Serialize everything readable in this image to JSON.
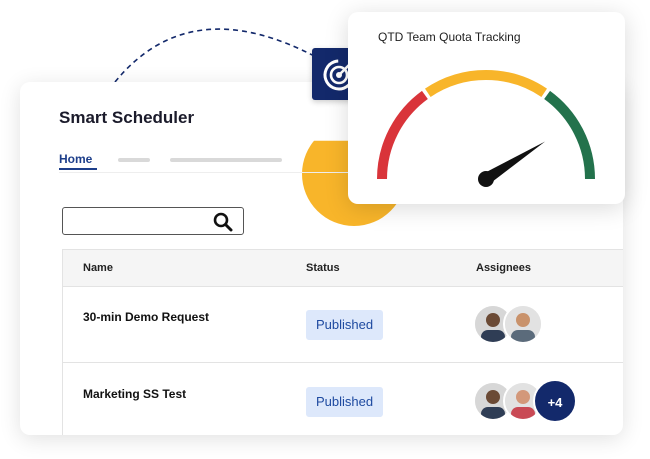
{
  "app": {
    "title": "Smart Scheduler",
    "nav": {
      "home_label": "Home"
    }
  },
  "search": {
    "placeholder": "",
    "value": ""
  },
  "table": {
    "headers": {
      "name": "Name",
      "status": "Status",
      "assignees": "Assignees"
    },
    "rows": [
      {
        "name": "30-min Demo Request",
        "status": "Published",
        "extra_assignees": ""
      },
      {
        "name": "Marketing SS Test",
        "status": "Published",
        "extra_assignees": "+4"
      }
    ]
  },
  "gauge": {
    "title": "QTD Team Quota Tracking",
    "value_fraction": 0.82
  },
  "colors": {
    "brand_navy": "#13296b",
    "accent_blue": "#1d3e8a",
    "badge_bg": "#dde8fb",
    "gauge_red": "#d9343a",
    "gauge_yellow": "#f8b52a",
    "gauge_green": "#23724c"
  },
  "icons": {
    "search": "search-icon",
    "target": "target-icon"
  }
}
